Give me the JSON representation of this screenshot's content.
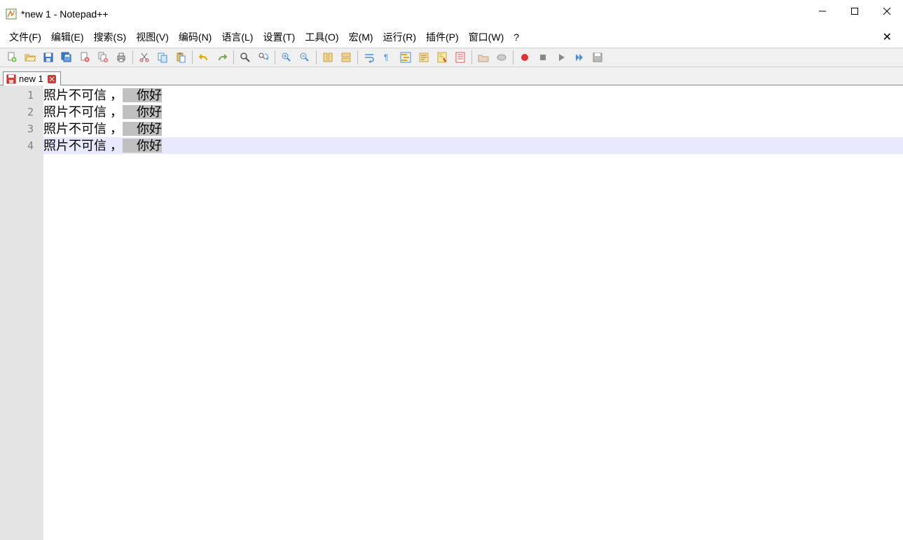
{
  "window": {
    "title": "*new 1 - Notepad++"
  },
  "menu": {
    "file": "文件(F)",
    "edit": "编辑(E)",
    "search": "搜索(S)",
    "view": "视图(V)",
    "encoding": "编码(N)",
    "language": "语言(L)",
    "settings": "设置(T)",
    "tools": "工具(O)",
    "macro": "宏(M)",
    "run": "运行(R)",
    "plugins": "插件(P)",
    "window": "窗口(W)",
    "help": "?"
  },
  "toolbar": {
    "new": "new",
    "open": "open",
    "save": "save",
    "save_all": "save-all",
    "close": "close",
    "close_all": "close-all",
    "print": "print",
    "cut": "cut",
    "copy": "copy",
    "paste": "paste",
    "undo": "undo",
    "redo": "redo",
    "find": "find",
    "replace": "replace",
    "zoom_in": "zoom-in",
    "zoom_out": "zoom-out",
    "sync_v": "sync-vertical",
    "sync_h": "sync-horizontal",
    "wrap": "word-wrap",
    "all_chars": "show-all-chars",
    "indent": "indent-guide",
    "udl": "user-lang",
    "doc_map": "doc-map",
    "doc_list": "doc-list",
    "func_list": "function-list",
    "folder": "folder-workspace",
    "monitor": "monitoring",
    "rec": "macro-record",
    "stop": "macro-stop",
    "play": "macro-play",
    "play_multi": "macro-play-multi",
    "save_macro": "macro-save"
  },
  "tabs": [
    {
      "label": "new 1",
      "modified": true
    }
  ],
  "editor": {
    "lines": [
      {
        "num": "1",
        "a": "照片不可信 ，",
        "b": "    ",
        "c": "你好",
        "selected": true,
        "current": false
      },
      {
        "num": "2",
        "a": "照片不可信 ，",
        "b": "    ",
        "c": "你好",
        "selected": true,
        "current": false
      },
      {
        "num": "3",
        "a": "照片不可信 ，",
        "b": "    ",
        "c": "你好",
        "selected": true,
        "current": false
      },
      {
        "num": "4",
        "a": "照片不可信 ，",
        "b": "    ",
        "c": "你好",
        "selected": true,
        "current": true
      }
    ]
  }
}
